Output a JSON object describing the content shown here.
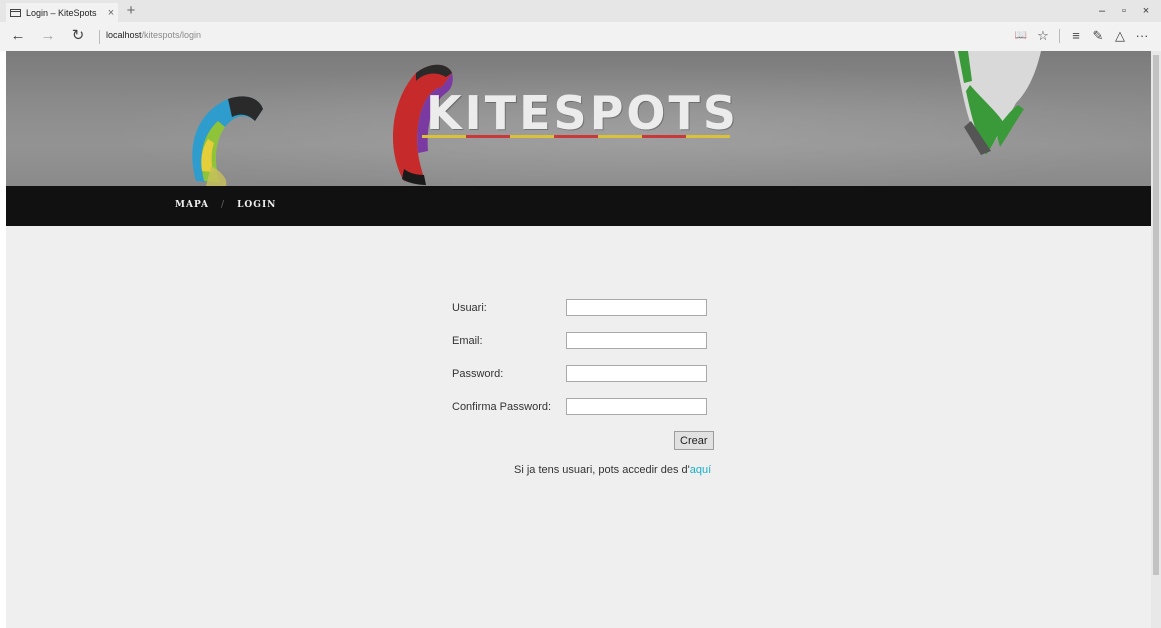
{
  "browser": {
    "tab_title": "Login – KiteSpots",
    "tab_close": "×",
    "new_tab": "+",
    "window_controls": {
      "minimize": "–",
      "restore": "▫",
      "close": "×"
    },
    "nav": {
      "back": "←",
      "forward": "→",
      "refresh": "↻"
    },
    "url_host": "localhost",
    "url_path": "/kitespots/login",
    "tools": {
      "reading_view": "📖",
      "favorite": "☆",
      "hub": "≡",
      "web_note": "✎",
      "share": "△",
      "more": "···"
    }
  },
  "site": {
    "logo": "KITESPOTS",
    "logo_colors": [
      "#d9c23a",
      "#c83a3a",
      "#d9c23a",
      "#c83a3a",
      "#d9c23a",
      "#c83a3a",
      "#d9c23a"
    ],
    "menu": [
      {
        "label": "MAPA"
      },
      {
        "label": "LOGIN"
      }
    ],
    "menu_separator": "/"
  },
  "form": {
    "fields": [
      {
        "label": "Usuari:",
        "value": ""
      },
      {
        "label": "Email:",
        "value": ""
      },
      {
        "label": "Password:",
        "value": ""
      },
      {
        "label": "Confirma Password:",
        "value": ""
      }
    ],
    "submit_label": "Crear",
    "signin_text": "Si ja tens usuari, pots accedir des d'",
    "signin_link": "aquí",
    "link_color": "#1ab0c9"
  }
}
